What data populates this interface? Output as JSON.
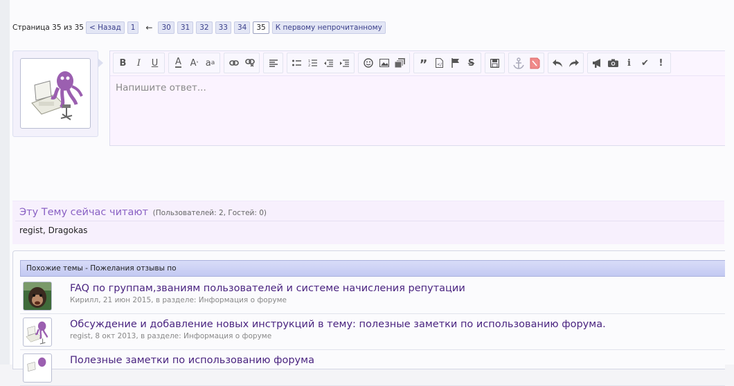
{
  "pagination": {
    "label": "Страница 35 из 35",
    "back": "< Назад",
    "first_page": "1",
    "arrow": "←",
    "pages": [
      "30",
      "31",
      "32",
      "33",
      "34",
      "35"
    ],
    "current": "35",
    "first_unread": "К первому непрочитанному"
  },
  "editor": {
    "placeholder": "Напишите ответ..."
  },
  "toolbar_icons": [
    [
      "bold-icon",
      "italic-icon",
      "underline-icon"
    ],
    [
      "font-color-icon",
      "font-size-icon",
      "font-family-icon"
    ],
    [
      "link-icon",
      "unlink-icon"
    ],
    [
      "align-icon"
    ],
    [
      "bullet-list-icon",
      "numbered-list-icon",
      "outdent-icon",
      "indent-icon"
    ],
    [
      "smilie-icon",
      "image-icon",
      "media-icon"
    ],
    [
      "quote-icon",
      "code-icon",
      "flag-icon",
      "strikethrough-icon"
    ],
    [
      "save-draft-icon"
    ],
    [
      "anchor-icon",
      "tag-icon"
    ],
    [
      "undo-icon",
      "redo-icon"
    ],
    [
      "megaphone-icon",
      "camera-icon",
      "info-icon",
      "check-icon",
      "exclamation-icon"
    ]
  ],
  "viewers": {
    "title": "Эту Тему сейчас читают",
    "counts": "(Пользователей: 2, Гостей: 0)",
    "users": "regist, Dragokas"
  },
  "similar": {
    "header": "Похожие темы - Пожелания отзывы по",
    "threads": [
      {
        "title": "FAQ по группам,званиям пользователей и системе начисления репутации",
        "meta": "Кирилл, 21 июн 2015, в разделе: Информация о форуме"
      },
      {
        "title": "Обсуждение и добавление новых инструкций в тему: полезные заметки по использованию форума.",
        "meta": "regist, 8 окт 2013, в разделе: Информация о форуме"
      },
      {
        "title": "Полезные заметки по использованию форума",
        "meta": ""
      }
    ]
  },
  "colors": {
    "accent": "#8a61c4",
    "link": "#4a2480",
    "header_bg": "#c3c9f2"
  }
}
